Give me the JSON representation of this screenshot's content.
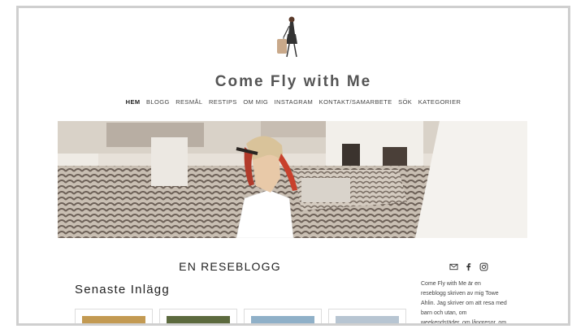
{
  "site": {
    "title": "Come Fly with Me"
  },
  "nav": {
    "items": [
      {
        "label": "HEM",
        "active": true
      },
      {
        "label": "BLOGG"
      },
      {
        "label": "RESMÅL"
      },
      {
        "label": "RESTIPS"
      },
      {
        "label": "OM MIG"
      },
      {
        "label": "INSTAGRAM"
      },
      {
        "label": "KONTAKT/SAMARBETE"
      },
      {
        "label": "SÖK"
      },
      {
        "label": "KATEGORIER"
      }
    ]
  },
  "main": {
    "heading": "EN RESEBLOGG",
    "section_heading": "Senaste Inlägg"
  },
  "sidebar": {
    "social_icons": [
      "mail-icon",
      "facebook-icon",
      "instagram-icon"
    ],
    "bio_lines": [
      "Come Fly with Me är en",
      "reseblogg skriven av mig Towe",
      "Ahlin. Jag skriver om att resa med",
      "barn och utan, om",
      "weekendstäder, om långresor, om"
    ]
  },
  "colors": {
    "title": "#555555",
    "border": "#cfcfcf",
    "hero_bg": "#d8cdc0"
  }
}
